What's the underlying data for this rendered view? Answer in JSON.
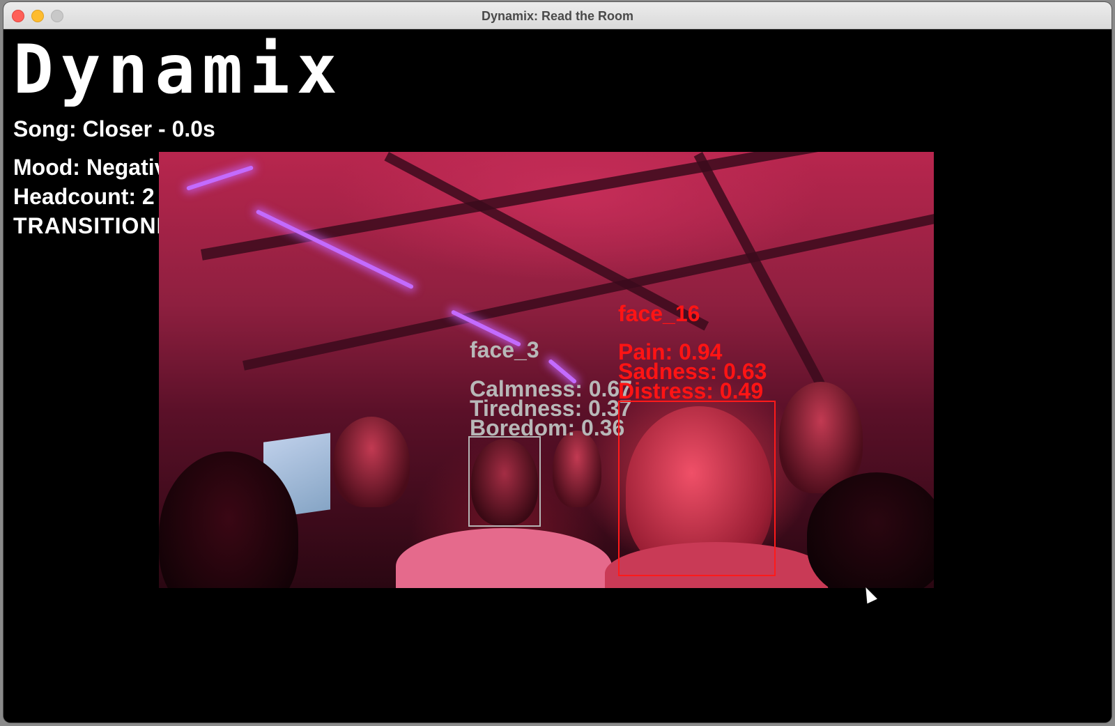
{
  "window": {
    "title": "Dynamix: Read the Room"
  },
  "app": {
    "logo": "Dynamix"
  },
  "status": {
    "song": "Song: Closer - 0.0s",
    "mood": "Mood: Negative",
    "headcount": "Headcount: 2",
    "state": "TRANSITIONING"
  },
  "faces": [
    {
      "id": "face_3",
      "emotions": [
        "Calmness: 0.67",
        "Tiredness: 0.37",
        "Boredom: 0.36"
      ],
      "color": "#b8b8b8"
    },
    {
      "id": "face_16",
      "emotions": [
        "Pain: 0.94",
        "Sadness: 0.63",
        "Distress: 0.49"
      ],
      "color": "#ff1414"
    }
  ],
  "colors": {
    "background": "#000000",
    "text": "#ffffff"
  }
}
